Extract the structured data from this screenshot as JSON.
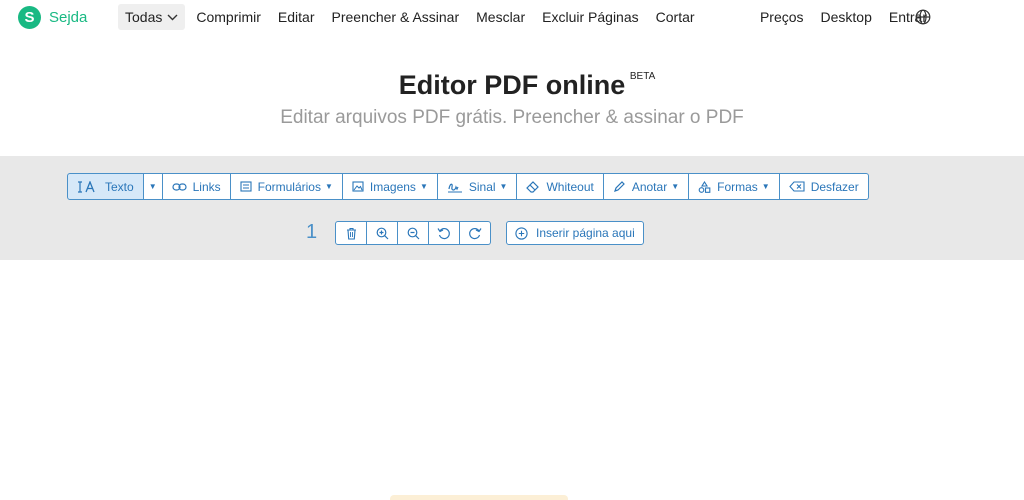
{
  "brand": {
    "name": "Sejda",
    "letter": "S",
    "color": "#19b983"
  },
  "nav": {
    "left": [
      {
        "label": "Todas",
        "active": true
      },
      {
        "label": "Comprimir"
      },
      {
        "label": "Editar"
      },
      {
        "label": "Preencher & Assinar"
      },
      {
        "label": "Mesclar"
      },
      {
        "label": "Excluir Páginas"
      },
      {
        "label": "Cortar"
      }
    ],
    "right": [
      {
        "label": "Preços"
      },
      {
        "label": "Desktop"
      },
      {
        "label": "Entrar"
      }
    ],
    "language_icon": "globe-icon"
  },
  "hero": {
    "title": "Editor PDF online",
    "badge": "BETA",
    "subtitle": "Editar arquivos PDF grátis. Preencher & assinar o PDF"
  },
  "toolbar": {
    "accent": "#4a90c8",
    "tools": [
      {
        "label": "Texto",
        "icon": "text-cursor-icon",
        "active": true
      },
      {
        "label": "Links",
        "icon": "link-icon"
      },
      {
        "label": "Formulários",
        "icon": "form-icon",
        "dropdown": true
      },
      {
        "label": "Imagens",
        "icon": "image-icon",
        "dropdown": true
      },
      {
        "label": "Sinal",
        "icon": "signature-icon",
        "dropdown": true
      },
      {
        "label": "Whiteout",
        "icon": "eraser-icon"
      },
      {
        "label": "Anotar",
        "icon": "pen-icon",
        "dropdown": true
      },
      {
        "label": "Formas",
        "icon": "shapes-icon",
        "dropdown": true
      },
      {
        "label": "Desfazer",
        "icon": "undo-icon"
      }
    ]
  },
  "page_tools": {
    "page_number": "1",
    "buttons": [
      "trash-icon",
      "zoom-in-icon",
      "zoom-out-icon",
      "rotate-left-icon",
      "rotate-right-icon"
    ],
    "insert_label": "Inserir página aqui"
  }
}
